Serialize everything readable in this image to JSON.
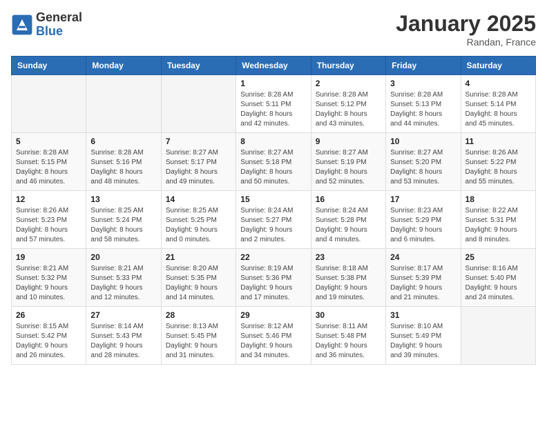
{
  "logo": {
    "general": "General",
    "blue": "Blue"
  },
  "title": "January 2025",
  "location": "Randan, France",
  "days_of_week": [
    "Sunday",
    "Monday",
    "Tuesday",
    "Wednesday",
    "Thursday",
    "Friday",
    "Saturday"
  ],
  "weeks": [
    [
      {
        "day": "",
        "info": ""
      },
      {
        "day": "",
        "info": ""
      },
      {
        "day": "",
        "info": ""
      },
      {
        "day": "1",
        "info": "Sunrise: 8:28 AM\nSunset: 5:11 PM\nDaylight: 8 hours\nand 42 minutes."
      },
      {
        "day": "2",
        "info": "Sunrise: 8:28 AM\nSunset: 5:12 PM\nDaylight: 8 hours\nand 43 minutes."
      },
      {
        "day": "3",
        "info": "Sunrise: 8:28 AM\nSunset: 5:13 PM\nDaylight: 8 hours\nand 44 minutes."
      },
      {
        "day": "4",
        "info": "Sunrise: 8:28 AM\nSunset: 5:14 PM\nDaylight: 8 hours\nand 45 minutes."
      }
    ],
    [
      {
        "day": "5",
        "info": "Sunrise: 8:28 AM\nSunset: 5:15 PM\nDaylight: 8 hours\nand 46 minutes."
      },
      {
        "day": "6",
        "info": "Sunrise: 8:28 AM\nSunset: 5:16 PM\nDaylight: 8 hours\nand 48 minutes."
      },
      {
        "day": "7",
        "info": "Sunrise: 8:27 AM\nSunset: 5:17 PM\nDaylight: 8 hours\nand 49 minutes."
      },
      {
        "day": "8",
        "info": "Sunrise: 8:27 AM\nSunset: 5:18 PM\nDaylight: 8 hours\nand 50 minutes."
      },
      {
        "day": "9",
        "info": "Sunrise: 8:27 AM\nSunset: 5:19 PM\nDaylight: 8 hours\nand 52 minutes."
      },
      {
        "day": "10",
        "info": "Sunrise: 8:27 AM\nSunset: 5:20 PM\nDaylight: 8 hours\nand 53 minutes."
      },
      {
        "day": "11",
        "info": "Sunrise: 8:26 AM\nSunset: 5:22 PM\nDaylight: 8 hours\nand 55 minutes."
      }
    ],
    [
      {
        "day": "12",
        "info": "Sunrise: 8:26 AM\nSunset: 5:23 PM\nDaylight: 8 hours\nand 57 minutes."
      },
      {
        "day": "13",
        "info": "Sunrise: 8:25 AM\nSunset: 5:24 PM\nDaylight: 8 hours\nand 58 minutes."
      },
      {
        "day": "14",
        "info": "Sunrise: 8:25 AM\nSunset: 5:25 PM\nDaylight: 9 hours\nand 0 minutes."
      },
      {
        "day": "15",
        "info": "Sunrise: 8:24 AM\nSunset: 5:27 PM\nDaylight: 9 hours\nand 2 minutes."
      },
      {
        "day": "16",
        "info": "Sunrise: 8:24 AM\nSunset: 5:28 PM\nDaylight: 9 hours\nand 4 minutes."
      },
      {
        "day": "17",
        "info": "Sunrise: 8:23 AM\nSunset: 5:29 PM\nDaylight: 9 hours\nand 6 minutes."
      },
      {
        "day": "18",
        "info": "Sunrise: 8:22 AM\nSunset: 5:31 PM\nDaylight: 9 hours\nand 8 minutes."
      }
    ],
    [
      {
        "day": "19",
        "info": "Sunrise: 8:21 AM\nSunset: 5:32 PM\nDaylight: 9 hours\nand 10 minutes."
      },
      {
        "day": "20",
        "info": "Sunrise: 8:21 AM\nSunset: 5:33 PM\nDaylight: 9 hours\nand 12 minutes."
      },
      {
        "day": "21",
        "info": "Sunrise: 8:20 AM\nSunset: 5:35 PM\nDaylight: 9 hours\nand 14 minutes."
      },
      {
        "day": "22",
        "info": "Sunrise: 8:19 AM\nSunset: 5:36 PM\nDaylight: 9 hours\nand 17 minutes."
      },
      {
        "day": "23",
        "info": "Sunrise: 8:18 AM\nSunset: 5:38 PM\nDaylight: 9 hours\nand 19 minutes."
      },
      {
        "day": "24",
        "info": "Sunrise: 8:17 AM\nSunset: 5:39 PM\nDaylight: 9 hours\nand 21 minutes."
      },
      {
        "day": "25",
        "info": "Sunrise: 8:16 AM\nSunset: 5:40 PM\nDaylight: 9 hours\nand 24 minutes."
      }
    ],
    [
      {
        "day": "26",
        "info": "Sunrise: 8:15 AM\nSunset: 5:42 PM\nDaylight: 9 hours\nand 26 minutes."
      },
      {
        "day": "27",
        "info": "Sunrise: 8:14 AM\nSunset: 5:43 PM\nDaylight: 9 hours\nand 28 minutes."
      },
      {
        "day": "28",
        "info": "Sunrise: 8:13 AM\nSunset: 5:45 PM\nDaylight: 9 hours\nand 31 minutes."
      },
      {
        "day": "29",
        "info": "Sunrise: 8:12 AM\nSunset: 5:46 PM\nDaylight: 9 hours\nand 34 minutes."
      },
      {
        "day": "30",
        "info": "Sunrise: 8:11 AM\nSunset: 5:48 PM\nDaylight: 9 hours\nand 36 minutes."
      },
      {
        "day": "31",
        "info": "Sunrise: 8:10 AM\nSunset: 5:49 PM\nDaylight: 9 hours\nand 39 minutes."
      },
      {
        "day": "",
        "info": ""
      }
    ]
  ]
}
